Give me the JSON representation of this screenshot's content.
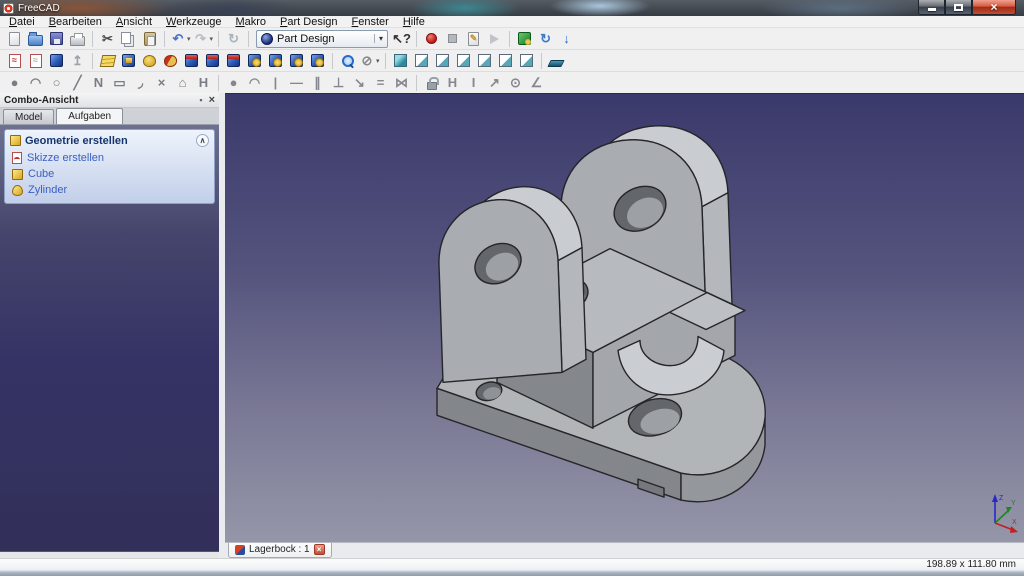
{
  "window": {
    "title": "FreeCAD",
    "controls": [
      {
        "name": "minimize"
      },
      {
        "name": "maximize"
      },
      {
        "name": "close"
      }
    ]
  },
  "menu_bar": {
    "items": [
      "Datei",
      "Bearbeiten",
      "Ansicht",
      "Werkzeuge",
      "Makro",
      "Part Design",
      "Fenster",
      "Hilfe"
    ]
  },
  "toolbars": {
    "standard": [
      {
        "name": "new-document",
        "kind": "k-doc"
      },
      {
        "name": "open-document",
        "kind": "k-folder"
      },
      {
        "name": "save-document",
        "kind": "k-save"
      },
      {
        "name": "print-document",
        "kind": "k-print"
      },
      {
        "t": "sep"
      },
      {
        "name": "cut",
        "glyph": "✂",
        "color": "#4a4a4a"
      },
      {
        "name": "copy",
        "kind": "k-copy"
      },
      {
        "name": "paste",
        "kind": "k-paste"
      },
      {
        "t": "sep"
      },
      {
        "name": "undo",
        "glyph": "↶",
        "color": "#4a72c8",
        "caret": true
      },
      {
        "name": "redo",
        "glyph": "↷",
        "color": "#b8bcc4",
        "caret": true
      },
      {
        "t": "sep"
      },
      {
        "name": "refresh",
        "glyph": "↻",
        "color": "#aab2ba"
      },
      {
        "t": "sep"
      },
      {
        "t": "combo",
        "name": "workbench-selector",
        "value": "Part Design"
      },
      {
        "name": "whats-this",
        "glyph": "↖?",
        "color": "#333333"
      },
      {
        "t": "sep"
      },
      {
        "name": "macro-record",
        "kind": "k-dot"
      },
      {
        "name": "macro-stop",
        "kind": "k-stop"
      },
      {
        "name": "macro-edit",
        "kind": "k-doc",
        "glyph": "✎",
        "color": "#c8922a"
      },
      {
        "name": "macro-play",
        "kind": "k-play"
      },
      {
        "t": "sep"
      },
      {
        "name": "parameter-editor",
        "kind": "k-green"
      },
      {
        "name": "web-reload",
        "glyph": "↻",
        "color": "#3a7ac8"
      },
      {
        "name": "download",
        "glyph": "↓",
        "color": "#2a6ac8"
      }
    ],
    "part_design": [
      {
        "name": "new-sketch",
        "kind": "k-sketch",
        "glyph": "≈",
        "color": "#c03030"
      },
      {
        "name": "edit-sketch",
        "kind": "k-sketch",
        "glyph": "≈",
        "color": "#b8a8a8"
      },
      {
        "name": "map-sketch",
        "kind": "k-cube-b"
      },
      {
        "name": "leave-sketch",
        "glyph": "↥",
        "color": "#9aa2aa"
      },
      {
        "t": "sep"
      },
      {
        "name": "pad",
        "kind": "k-pad"
      },
      {
        "name": "pocket",
        "kind": "k-pocket"
      },
      {
        "name": "revolution",
        "kind": "k-rev"
      },
      {
        "name": "groove",
        "kind": "k-groove"
      },
      {
        "name": "fillet",
        "kind": "k-cube-rb"
      },
      {
        "name": "chamfer",
        "kind": "k-cube-rb"
      },
      {
        "name": "draft",
        "kind": "k-cube-rb"
      },
      {
        "name": "mirrored",
        "kind": "k-cube-by"
      },
      {
        "name": "linear-pattern",
        "kind": "k-cube-by"
      },
      {
        "name": "polar-pattern",
        "kind": "k-cube-by"
      },
      {
        "name": "multi-transform",
        "kind": "k-cube-by"
      },
      {
        "t": "sep"
      },
      {
        "name": "zoom-fit-all",
        "kind": "k-mag"
      },
      {
        "name": "draw-style",
        "glyph": "⊘",
        "color": "#888888",
        "caret": true
      },
      {
        "t": "sep"
      },
      {
        "name": "view-axonometric",
        "kind": "k-vcube-iso"
      },
      {
        "name": "view-front",
        "kind": "k-vcube"
      },
      {
        "name": "view-top",
        "kind": "k-vcube"
      },
      {
        "name": "view-right",
        "kind": "k-vcube"
      },
      {
        "name": "view-rear",
        "kind": "k-vcube"
      },
      {
        "name": "view-bottom",
        "kind": "k-vcube"
      },
      {
        "name": "view-left",
        "kind": "k-vcube"
      },
      {
        "t": "sep"
      },
      {
        "name": "measure",
        "kind": "k-measure"
      }
    ],
    "sketcher": [
      {
        "name": "create-point",
        "glyph": "●",
        "color": "#7a7e84"
      },
      {
        "name": "create-arc",
        "glyph": "◠",
        "color": "#7a7e84"
      },
      {
        "name": "create-circle",
        "glyph": "○",
        "color": "#7a7e84"
      },
      {
        "name": "create-line",
        "glyph": "╱",
        "color": "#7a7e84"
      },
      {
        "name": "create-polyline",
        "glyph": "N",
        "color": "#7a7e84"
      },
      {
        "name": "create-rectangle",
        "glyph": "▭",
        "color": "#7a7e84"
      },
      {
        "name": "create-fillet",
        "glyph": "◞",
        "color": "#7a7e84"
      },
      {
        "name": "trim-edge",
        "glyph": "×",
        "color": "#7a7e84"
      },
      {
        "name": "external-geometry",
        "glyph": "⌂",
        "color": "#7a7e84"
      },
      {
        "name": "toggle-construction",
        "glyph": "H",
        "color": "#7a7e84"
      },
      {
        "t": "sep"
      },
      {
        "name": "constrain-coincident",
        "glyph": "●",
        "color": "#84888e"
      },
      {
        "name": "constrain-point-on-object",
        "glyph": "◠",
        "color": "#84888e"
      },
      {
        "name": "constrain-vertical",
        "glyph": "|",
        "color": "#84888e"
      },
      {
        "name": "constrain-horizontal",
        "glyph": "—",
        "color": "#84888e"
      },
      {
        "name": "constrain-parallel",
        "glyph": "∥",
        "color": "#84888e"
      },
      {
        "name": "constrain-perpendicular",
        "glyph": "⊥",
        "color": "#84888e"
      },
      {
        "name": "constrain-tangent",
        "glyph": "↘",
        "color": "#84888e"
      },
      {
        "name": "constrain-equal",
        "glyph": "=",
        "color": "#84888e"
      },
      {
        "name": "constrain-symmetric",
        "glyph": "⋈",
        "color": "#84888e"
      },
      {
        "t": "sep"
      },
      {
        "name": "constrain-lock",
        "kind": "k-lock"
      },
      {
        "name": "constrain-distance-x",
        "glyph": "H",
        "color": "#84888e"
      },
      {
        "name": "constrain-distance-y",
        "glyph": "I",
        "color": "#84888e"
      },
      {
        "name": "constrain-distance",
        "glyph": "↗",
        "color": "#84888e"
      },
      {
        "name": "constrain-radius",
        "glyph": "⊙",
        "color": "#84888e"
      },
      {
        "name": "constrain-angle",
        "glyph": "∠",
        "color": "#84888e"
      }
    ]
  },
  "combo_view": {
    "title": "Combo-Ansicht",
    "tabs": [
      {
        "label": "Model",
        "active": false
      },
      {
        "label": "Aufgaben",
        "active": true
      }
    ],
    "task_panel": {
      "header": "Geometrie erstellen",
      "items": [
        {
          "label": "Skizze erstellen",
          "icon": "sketch"
        },
        {
          "label": "Cube",
          "icon": "cube"
        },
        {
          "label": "Zylinder",
          "icon": "cylinder"
        }
      ]
    }
  },
  "document_tabs": [
    {
      "label": "Lagerbock : 1",
      "active": true,
      "closable": true
    }
  ],
  "viewport": {
    "axis_indicator": {
      "x": "X",
      "y": "Y",
      "z": "Z"
    }
  },
  "status_bar": {
    "dimension_readout": "198.89 x 111.80 mm"
  },
  "colors": {
    "viewport_top": "#3a396b",
    "viewport_bottom": "#9596a9",
    "panel_top": "#6e7190",
    "panel_bottom": "#323059",
    "task_link": "#3a5fc0",
    "accent_red": "#c0392b"
  }
}
